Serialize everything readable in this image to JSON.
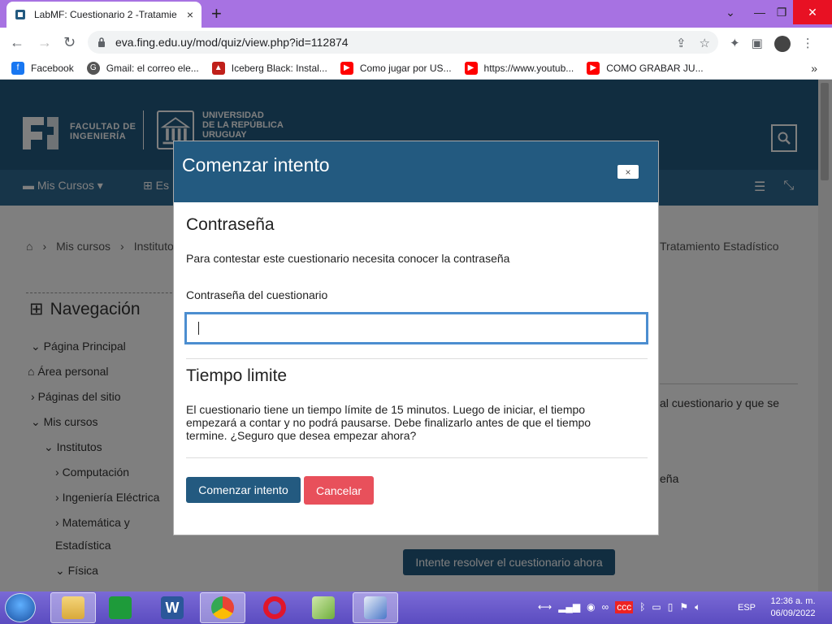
{
  "browser": {
    "tab_title": "LabMF: Cuestionario 2 -Tratamie",
    "tab_close": "×",
    "new_tab": "+",
    "window_controls": {
      "minimize": "⌄",
      "restore": "—",
      "maximize": "❐",
      "close": "✕"
    },
    "url": "eva.fing.edu.uy/mod/quiz/view.php?id=112874",
    "bookmarks": [
      {
        "label": "Facebook",
        "icon": "facebook-icon",
        "color": "#1877f2"
      },
      {
        "label": "Gmail: el correo ele...",
        "icon": "google-icon",
        "color": "#555555"
      },
      {
        "label": "Iceberg Black: Instal...",
        "icon": "iceberg-icon",
        "color": "#c0201a"
      },
      {
        "label": "Como jugar por US...",
        "icon": "youtube-icon",
        "color": "#ff0000"
      },
      {
        "label": "https://www.youtub...",
        "icon": "youtube-icon",
        "color": "#ff0000"
      },
      {
        "label": "COMO GRABAR JU...",
        "icon": "youtube-icon",
        "color": "#ff0000"
      }
    ],
    "bookmarks_more": "»"
  },
  "site": {
    "faculty_logo": "FACULTAD DE\nINGENIERÍA",
    "udelar_logo": "UNIVERSIDAD\nDE LA REPÚBLICA\nURUGUAY",
    "nav": {
      "mis_cursos": "Mis Cursos ▾",
      "es": "Es"
    },
    "breadcrumb": [
      "Mis cursos",
      "Instituto"
    ],
    "breadcrumb_right": "Tratamiento Estadístico",
    "navigation_title": "Navegación",
    "tree": [
      {
        "label": "Página Principal",
        "prefix": "⌄"
      },
      {
        "label": "Área personal",
        "prefix": "⌂"
      },
      {
        "label": "Páginas del sitio",
        "prefix": "›"
      },
      {
        "label": "Mis cursos",
        "prefix": "⌄"
      },
      {
        "label": "Institutos",
        "prefix": "⌄"
      },
      {
        "label": "Computación",
        "prefix": "›"
      },
      {
        "label": "Ingeniería Eléctrica",
        "prefix": "›"
      },
      {
        "label": "Matemática y",
        "prefix": "›"
      },
      {
        "label": "Estadística",
        "prefix": ""
      },
      {
        "label": "Física",
        "prefix": "⌄"
      }
    ],
    "right_text_1": "al cuestionario y que se",
    "right_text_2": "eña",
    "start_now_button": "Intente resolver el cuestionario ahora"
  },
  "modal": {
    "title": "Comenzar intento",
    "close": "×",
    "password_heading": "Contraseña",
    "password_text": "Para contestar este cuestionario necesita conocer la contraseña",
    "password_label": "Contraseña del cuestionario",
    "password_value": "",
    "time_heading": "Tiempo limite",
    "time_text": "El cuestionario tiene un tiempo límite de 15 minutos. Luego de iniciar, el tiempo empezará a contar y no podrá pausarse. Debe finalizarlo antes de que el tiempo termine. ¿Seguro que desea empezar ahora?",
    "start_button": "Comenzar intento",
    "cancel_button": "Cancelar"
  },
  "taskbar": {
    "apps": [
      "file-explorer-icon",
      "store-icon",
      "word-icon",
      "chrome-icon",
      "opera-icon",
      "pencil-app-icon",
      "network-app-icon"
    ],
    "language": "ESP",
    "time": "12:36 a. m.",
    "date": "06/09/2022"
  },
  "colors": {
    "brand": "#235a80",
    "cancel": "#e8505b",
    "tabstrip": "#a772e2"
  }
}
